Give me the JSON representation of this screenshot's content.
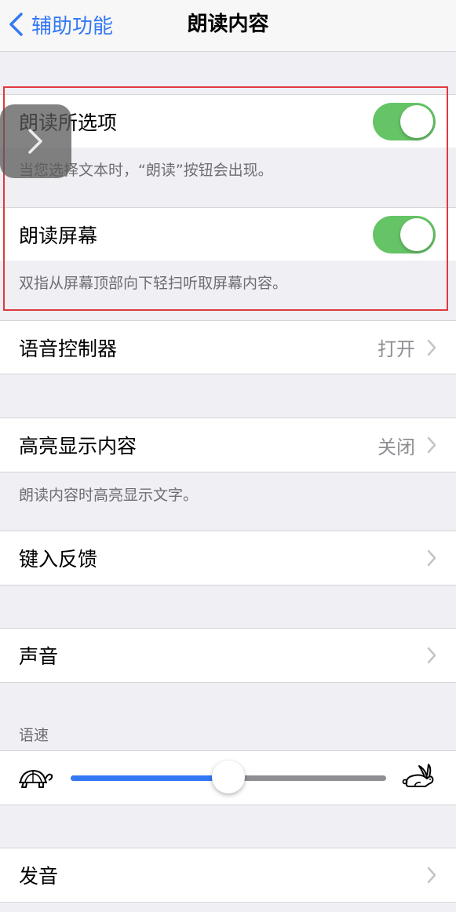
{
  "nav": {
    "back_label": "辅助功能",
    "title": "朗读内容"
  },
  "speak_selection": {
    "label": "朗读所选项",
    "enabled": true,
    "footer": "当您选择文本时，“朗读”按钮会出现。"
  },
  "speak_screen": {
    "label": "朗读屏幕",
    "enabled": true,
    "footer": "双指从屏幕顶部向下轻扫听取屏幕内容。"
  },
  "speech_controller": {
    "label": "语音控制器",
    "value": "打开"
  },
  "highlight_content": {
    "label": "高亮显示内容",
    "value": "关闭",
    "footer": "朗读内容时高亮显示文字。"
  },
  "typing_feedback": {
    "label": "键入反馈"
  },
  "voices": {
    "label": "声音"
  },
  "speaking_rate": {
    "header": "语速",
    "value": 0.5,
    "slow_icon": "turtle-icon",
    "fast_icon": "rabbit-icon"
  },
  "pronunciations": {
    "label": "发音"
  },
  "colors": {
    "accent": "#3478f6",
    "toggle_on": "#65c466",
    "highlight_box": "#e0393e"
  }
}
